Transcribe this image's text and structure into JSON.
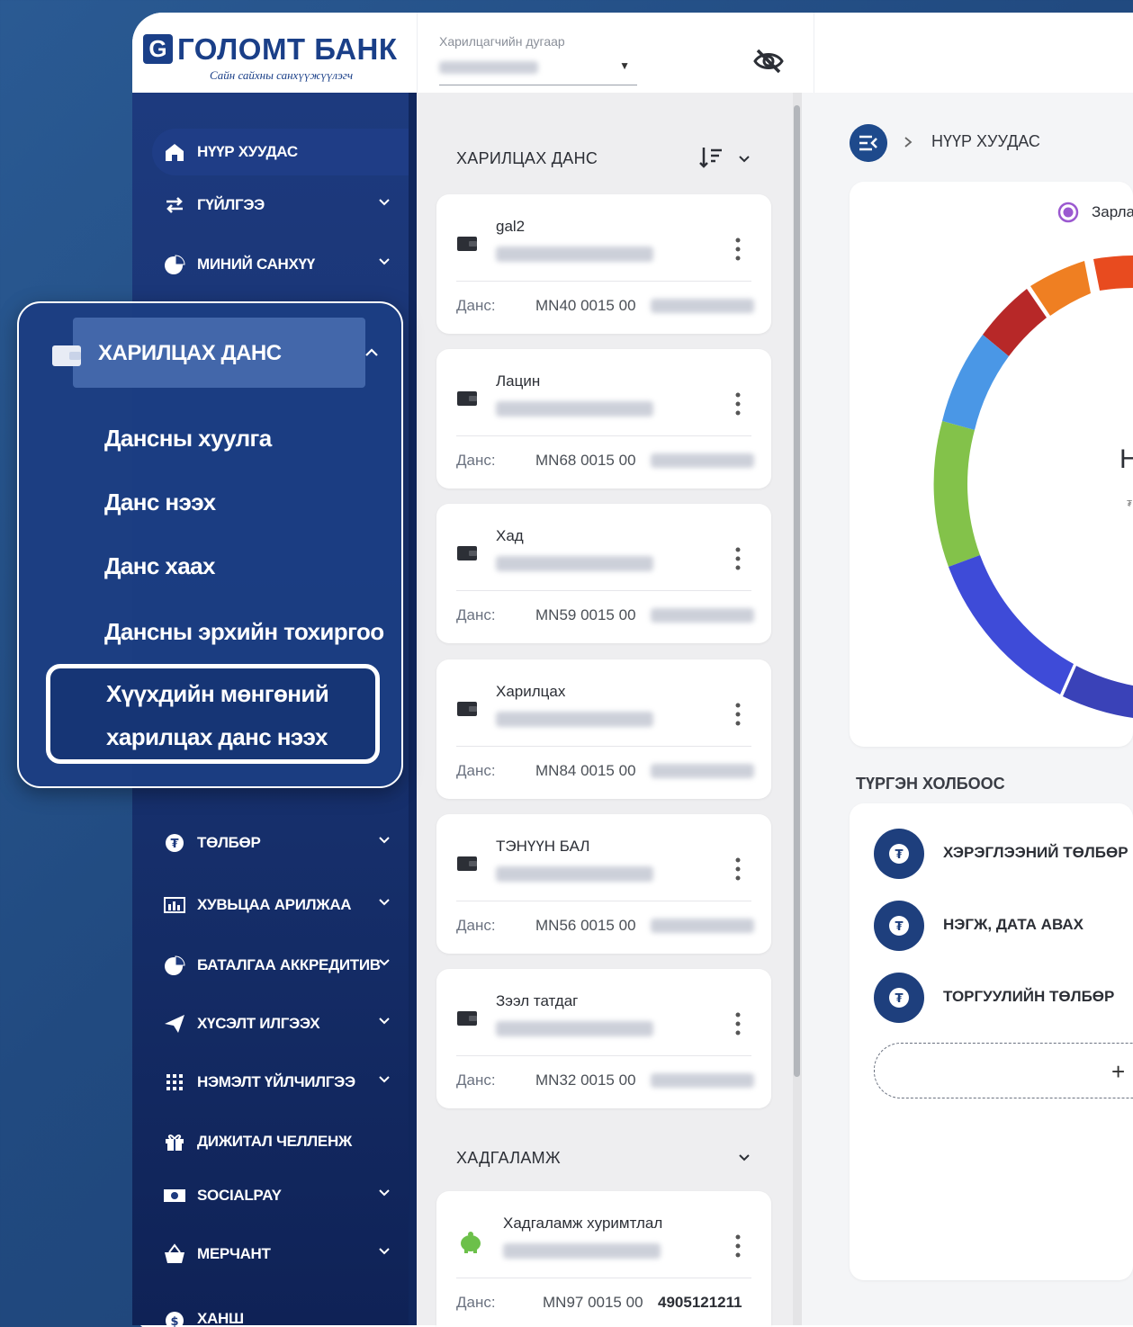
{
  "header": {
    "bank_name": "ГОЛОМТ БАНК",
    "bank_tagline": "Сайн сайхны санхүүжүүлэгч",
    "customer_label": "Харилцагчийн дугаар"
  },
  "sidebar": {
    "items": [
      {
        "label": "НҮҮР ХУУДАС",
        "icon": "home-icon"
      },
      {
        "label": "ГҮЙЛГЭЭ",
        "icon": "transfer-icon"
      },
      {
        "label": "МИНИЙ САНХҮҮ",
        "icon": "pie-chart-icon"
      },
      {
        "label": "ТӨЛБӨР",
        "icon": "coin-icon"
      },
      {
        "label": "ХУВЬЦАА АРИЛЖАА",
        "icon": "stock-chart-icon"
      },
      {
        "label": "БАТАЛГАА АККРЕДИТИВ",
        "icon": "pie-chart-icon"
      },
      {
        "label": "ХҮСЭЛТ ИЛГЭЭХ",
        "icon": "send-icon"
      },
      {
        "label": "НЭМЭЛТ ҮЙЛЧИЛГЭЭ",
        "icon": "grid-icon"
      },
      {
        "label": "ДИЖИТАЛ ЧЕЛЛЕНЖ",
        "icon": "gift-icon"
      },
      {
        "label": "SOCIALPAY",
        "icon": "cash-icon"
      },
      {
        "label": "МЕРЧАНТ",
        "icon": "basket-icon"
      },
      {
        "label": "ХАНШ",
        "icon": "currency-icon"
      }
    ]
  },
  "popup": {
    "title": "ХАРИЛЦАХ ДАНС",
    "items": [
      "Дансны хуулга",
      "Данс нээх",
      "Данс хаах",
      "Дансны эрхийн тохиргоо"
    ],
    "highlighted": "Хүүхдийн мөнгөний харилцах данс нээх"
  },
  "middle": {
    "section_accounts": "ХАРИЛЦАХ ДАНС",
    "section_savings": "ХАДГАЛАМЖ",
    "account_label": "Данс:",
    "accounts": [
      {
        "name": "gal2",
        "iban": "MN40 0015 00"
      },
      {
        "name": "Лацин",
        "iban": "MN68 0015 00"
      },
      {
        "name": "Хад",
        "iban": "MN59 0015 00"
      },
      {
        "name": "Харилцах",
        "iban": "MN84 0015 00"
      },
      {
        "name": "ТЭНҮҮН БАЛ",
        "iban": "MN56 0015 00"
      },
      {
        "name": "Зээл татдаг",
        "iban": "MN32 0015 00"
      }
    ],
    "savings": [
      {
        "name": "Хадгаламж хуримтлал",
        "iban": "MN97 0015 00",
        "number": "4905121211"
      }
    ]
  },
  "right": {
    "breadcrumb": "НҮҮР ХУУДАС",
    "legend": "Зарла",
    "chart_center": "Н",
    "chart_center_sub": "₮",
    "quick_links_title": "ТҮРГЭН ХОЛБООС",
    "quick_links": [
      "ХЭРЭГЛЭЭНИЙ ТӨЛБӨР",
      "НЭГЖ, ДАТА АВАХ",
      "ТОРГУУЛИЙН ТӨЛБӨР"
    ],
    "add_label": "+"
  },
  "colors": {
    "brand": "#1a3f88",
    "sidebar": "#1d3a7e",
    "legend": "#9b59d0"
  }
}
